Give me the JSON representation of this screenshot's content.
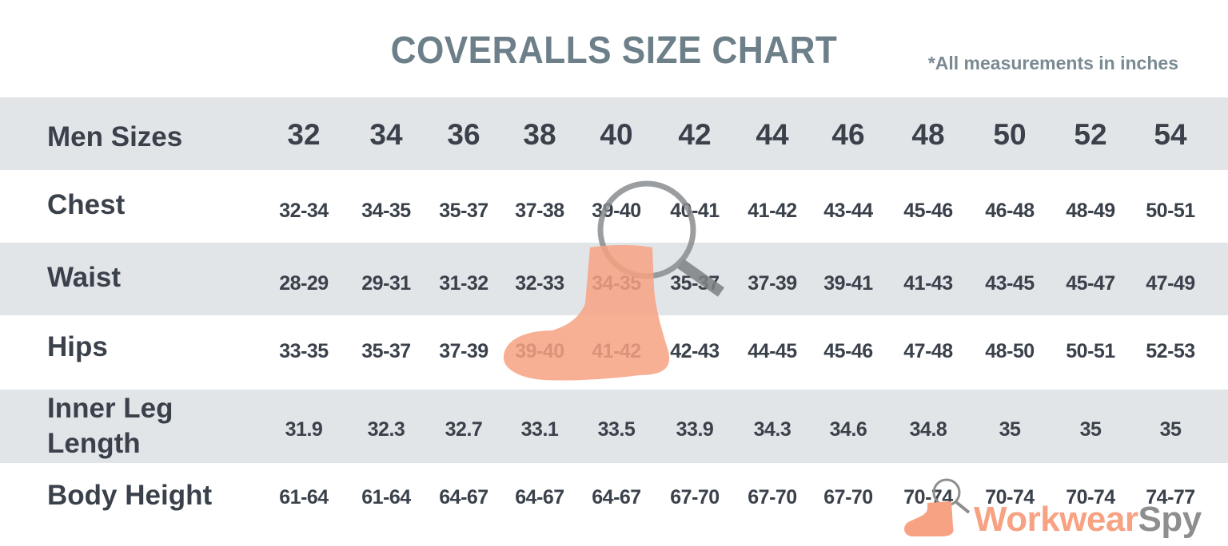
{
  "header": {
    "title": "COVERALLS SIZE CHART",
    "note": "*All measurements in inches"
  },
  "colors": {
    "title": "#6d7f89",
    "text": "#3a414b",
    "stripe": "#e2e5e8",
    "boot": "#f7a282",
    "magnifier": "#8e8e8e"
  },
  "chart_data": {
    "type": "table",
    "title": "COVERALLS SIZE CHART",
    "subtitle": "*All measurements in inches",
    "columns_label": "Men Sizes",
    "columns": [
      "32",
      "34",
      "36",
      "38",
      "40",
      "42",
      "44",
      "46",
      "48",
      "50",
      "52",
      "54"
    ],
    "rows": [
      {
        "label": "Chest",
        "values": [
          "32-34",
          "34-35",
          "35-37",
          "37-38",
          "39-40",
          "40-41",
          "41-42",
          "43-44",
          "45-46",
          "46-48",
          "48-49",
          "50-51"
        ]
      },
      {
        "label": "Waist",
        "values": [
          "28-29",
          "29-31",
          "31-32",
          "32-33",
          "34-35",
          "35-37",
          "37-39",
          "39-41",
          "41-43",
          "43-45",
          "45-47",
          "47-49"
        ]
      },
      {
        "label": "Hips",
        "values": [
          "33-35",
          "35-37",
          "37-39",
          "39-40",
          "41-42",
          "42-43",
          "44-45",
          "45-46",
          "47-48",
          "48-50",
          "50-51",
          "52-53"
        ]
      },
      {
        "label": "Inner Leg Length",
        "label_lines": [
          "Inner Leg",
          "Length"
        ],
        "values": [
          "31.9",
          "32.3",
          "32.7",
          "33.1",
          "33.5",
          "33.9",
          "34.3",
          "34.6",
          "34.8",
          "35",
          "35",
          "35"
        ]
      },
      {
        "label": "Body Height",
        "values": [
          "61-64",
          "61-64",
          "64-67",
          "64-67",
          "64-67",
          "67-70",
          "67-70",
          "67-70",
          "70-74",
          "70-74",
          "70-74",
          "74-77"
        ]
      }
    ]
  },
  "logo": {
    "part1": "Workwear",
    "part2": "Spy",
    "boot_icon": "boot-icon",
    "magnifier_icon": "magnifier-icon"
  }
}
